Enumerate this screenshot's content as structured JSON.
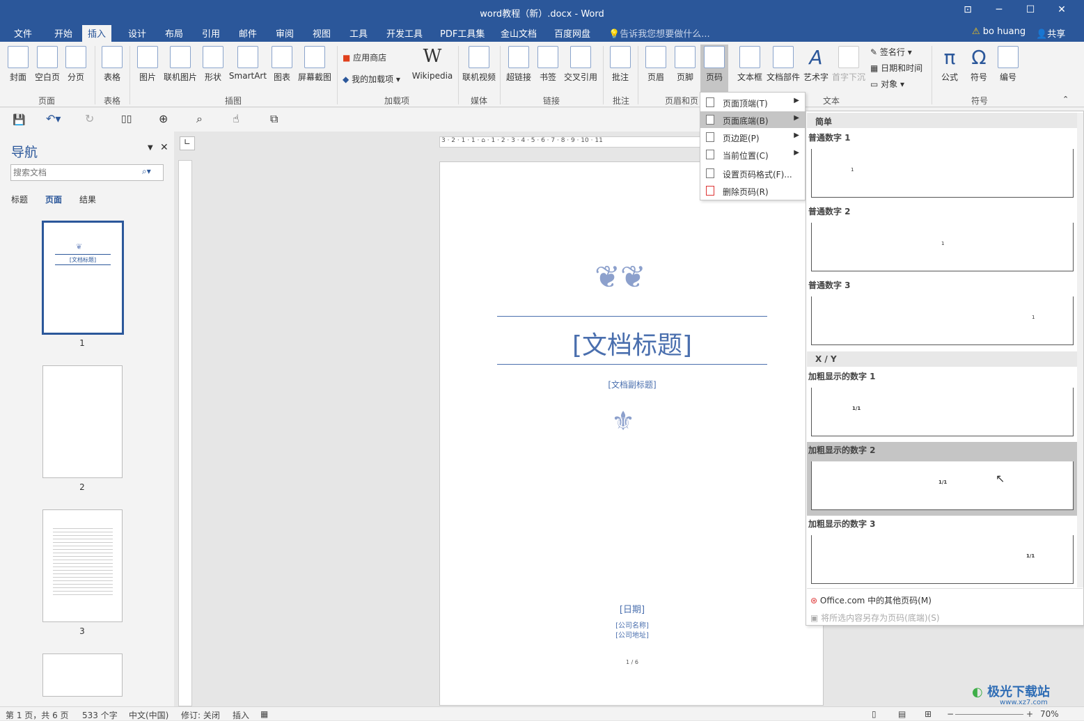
{
  "window": {
    "title": "word教程（新）.docx - Word"
  },
  "tabs": [
    "文件",
    "开始",
    "插入",
    "设计",
    "布局",
    "引用",
    "邮件",
    "审阅",
    "视图",
    "工具",
    "开发工具",
    "PDF工具集",
    "金山文档",
    "百度网盘"
  ],
  "active_tab": "插入",
  "tell_me": "告诉我您想要做什么...",
  "user": "bo huang",
  "share": "共享",
  "ribbon": {
    "pages_buttons": [
      "封面",
      "空白页",
      "分页"
    ],
    "table_button": "表格",
    "illus_buttons": [
      "图片",
      "联机图片",
      "形状",
      "SmartArt",
      "图表",
      "屏幕截图"
    ],
    "addin_store": "应用商店",
    "addin_my": "我的加载项",
    "addin_wiki": "Wikipedia",
    "media_button": "联机视频",
    "link_buttons": [
      "超链接",
      "书签",
      "交叉引用"
    ],
    "comment_button": "批注",
    "hf_buttons": [
      "页眉",
      "页脚",
      "页码"
    ],
    "text_buttons": [
      "文本框",
      "文档部件",
      "艺术字",
      "首字下沉"
    ],
    "text_small": [
      "签名行",
      "日期和时间",
      "对象"
    ],
    "symbol_buttons": [
      "公式",
      "符号",
      "编号"
    ],
    "groups": [
      "页面",
      "表格",
      "插图",
      "加载项",
      "媒体",
      "链接",
      "批注",
      "页眉和页脚",
      "文本",
      "符号"
    ]
  },
  "nav": {
    "title": "导航",
    "search_placeholder": "搜索文档",
    "tabs": [
      "标题",
      "页面",
      "结果"
    ],
    "pages": [
      "1",
      "2",
      "3"
    ]
  },
  "thumb1": {
    "title": "[文档标题]"
  },
  "ruler_top": "3 · 2 · 1 · 1 · ⌂ · 1 · 2 · 3 · 4 · 5 · 6 · 7 · 8 · 9 · 10 · 11",
  "doc": {
    "title": "[文档标题]",
    "subtitle": "[文档副标题]",
    "date": "[日期]",
    "company": "[公司名称]",
    "address": "[公司地址]",
    "page_num": "1 / 6"
  },
  "menu": [
    "页面顶端(T)",
    "页面底端(B)",
    "页边距(P)",
    "当前位置(C)",
    "设置页码格式(F)...",
    "删除页码(R)"
  ],
  "gallery": {
    "section_simple": "简单",
    "items_simple": [
      {
        "label": "普通数字 1",
        "sample": "1"
      },
      {
        "label": "普通数字 2",
        "sample": "1"
      },
      {
        "label": "普通数字 3",
        "sample": "1"
      }
    ],
    "section_xy": "X / Y",
    "items_xy": [
      {
        "label": "加粗显示的数字 1",
        "sample": "1/1"
      },
      {
        "label": "加粗显示的数字 2",
        "sample": "1/1"
      },
      {
        "label": "加粗显示的数字 3",
        "sample": "1/1"
      }
    ],
    "footer1": "Office.com 中的其他页码(M)",
    "footer2": "将所选内容另存为页码(底端)(S)"
  },
  "status": {
    "page": "第 1 页，共 6 页",
    "words": "533 个字",
    "lang": "中文(中国)",
    "track": "修订: 关闭",
    "mode": "插入",
    "zoom": "70%"
  },
  "watermark": "极光下载站",
  "watermark_url": "www.xz7.com"
}
